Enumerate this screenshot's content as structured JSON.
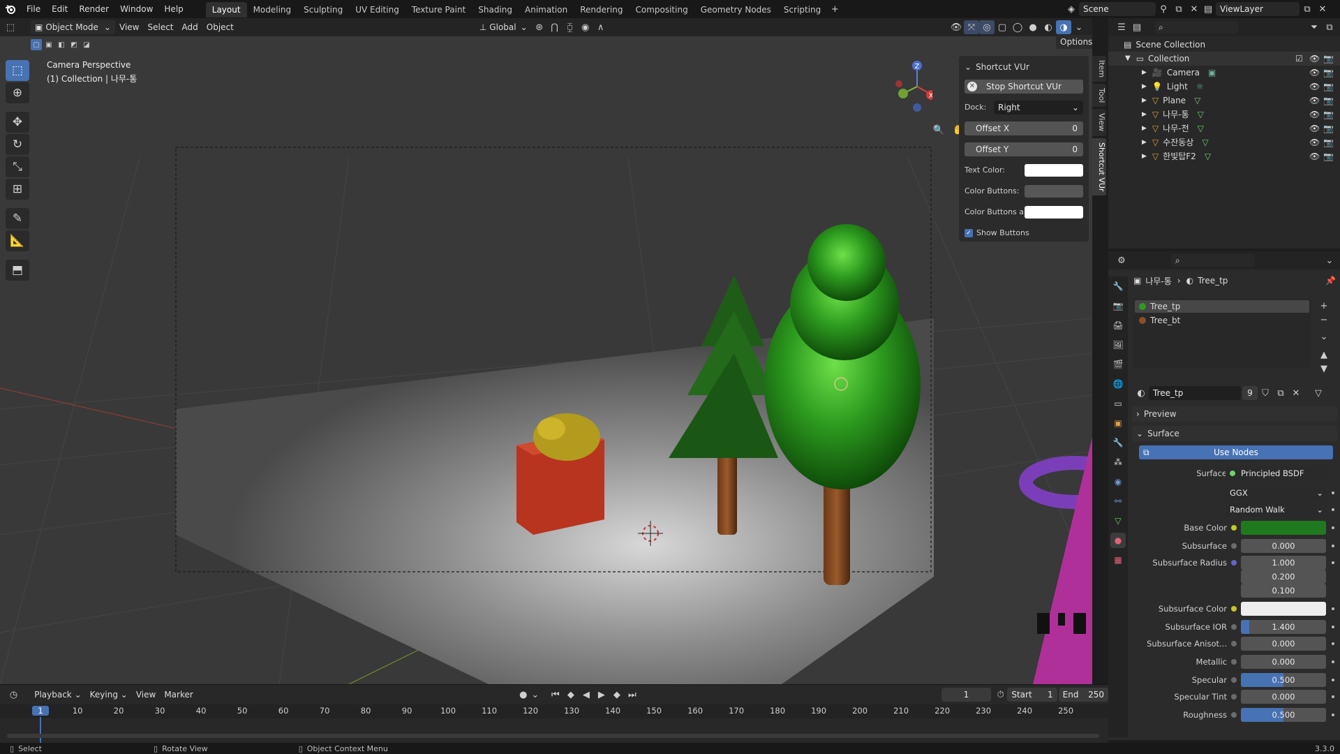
{
  "menu": {
    "file": "File",
    "edit": "Edit",
    "render": "Render",
    "window": "Window",
    "help": "Help"
  },
  "workspaces": [
    "Layout",
    "Modeling",
    "Sculpting",
    "UV Editing",
    "Texture Paint",
    "Shading",
    "Animation",
    "Rendering",
    "Compositing",
    "Geometry Nodes",
    "Scripting"
  ],
  "scene": {
    "name": "Scene",
    "view_layer": "ViewLayer"
  },
  "viewport": {
    "mode": "Object Mode",
    "menu_view": "View",
    "menu_select": "Select",
    "menu_add": "Add",
    "menu_object": "Object",
    "transform_orientation": "Global",
    "options": "Options",
    "overlay_title": "Camera Perspective",
    "overlay_subtitle": "(1) Collection | 나무-통",
    "gizmo_z": "Z",
    "gizmo_x": "X"
  },
  "shortcut_panel": {
    "title": "Shortcut VUr",
    "stop_button": "Stop Shortcut VUr",
    "dock_label": "Dock:",
    "dock_value": "Right",
    "offset_x_label": "Offset X",
    "offset_x_value": "0",
    "offset_y_label": "Offset Y",
    "offset_y_value": "0",
    "text_color_label": "Text Color:",
    "color_buttons_label": "Color Buttons:",
    "color_buttons_a_label": "Color Buttons a...",
    "show_buttons_label": "Show Buttons"
  },
  "n_tabs": [
    "Item",
    "Tool",
    "View",
    "Shortcut VUr"
  ],
  "outliner": {
    "root": "Scene Collection",
    "collection": "Collection",
    "items": [
      "Camera",
      "Light",
      "Plane",
      "나무-통",
      "나무-전",
      "수잔동상",
      "한빛탑F2"
    ]
  },
  "properties": {
    "breadcrumb_object": "나무-통",
    "breadcrumb_material": "Tree_tp",
    "slots": [
      "Tree_tp",
      "Tree_bt"
    ],
    "material_name": "Tree_tp",
    "user_count": "9",
    "preview_label": "Preview",
    "surface_label": "Surface",
    "use_nodes": "Use Nodes",
    "surface_field_label": "Surface",
    "surface_value": "Principled BSDF",
    "distribution": "GGX",
    "subsurface_method": "Random Walk",
    "base_color_label": "Base Color",
    "base_color": "#1f7a1f",
    "rows": [
      {
        "label": "Subsurface",
        "value": "0.000",
        "fill": 0
      },
      {
        "label": "Subsurface Radius",
        "value": "1.000",
        "fill": 0
      },
      {
        "label": "",
        "value": "0.200",
        "fill": 0
      },
      {
        "label": "",
        "value": "0.100",
        "fill": 0
      },
      {
        "label": "Subsurface Color",
        "value": "",
        "fill": 0
      },
      {
        "label": "Subsurface IOR",
        "value": "1.400",
        "fill": 0.1
      },
      {
        "label": "Subsurface Anisot...",
        "value": "0.000",
        "fill": 0
      },
      {
        "label": "Metallic",
        "value": "0.000",
        "fill": 0
      },
      {
        "label": "Specular",
        "value": "0.500",
        "fill": 0.5
      },
      {
        "label": "Specular Tint",
        "value": "0.000",
        "fill": 0
      },
      {
        "label": "Roughness",
        "value": "0.500",
        "fill": 0.5
      }
    ]
  },
  "timeline": {
    "playback": "Playback",
    "keying": "Keying",
    "view": "View",
    "marker": "Marker",
    "current_frame": "1",
    "start_label": "Start",
    "start_value": "1",
    "end_label": "End",
    "end_value": "250",
    "ruler": [
      "1",
      "10",
      "20",
      "30",
      "40",
      "50",
      "60",
      "70",
      "80",
      "90",
      "100",
      "110",
      "120",
      "130",
      "140",
      "150",
      "160",
      "170",
      "180",
      "190",
      "200",
      "210",
      "220",
      "230",
      "240",
      "250"
    ]
  },
  "status": {
    "select": "Select",
    "rotate": "Rotate View",
    "context": "Object Context Menu",
    "version": "3.3.0"
  },
  "colors": {
    "accent": "#4772b3",
    "tree_green": "#2f9a22",
    "box_red": "#b8341e",
    "suzanne_yellow": "#b39b1e",
    "torus_purple": "#7a3fb8"
  }
}
